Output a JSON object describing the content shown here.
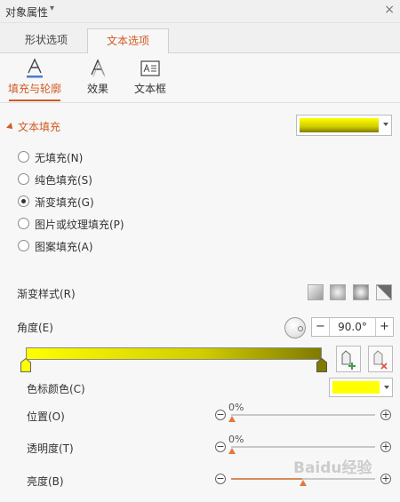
{
  "titlebar": {
    "title": "对象属性",
    "caret": "▾",
    "close": "×"
  },
  "tabs": [
    {
      "label": "形状选项",
      "active": false
    },
    {
      "label": "文本选项",
      "active": true
    }
  ],
  "subtabs": [
    {
      "label": "填充与轮廓",
      "icon": "text-fill-outline-icon",
      "active": true
    },
    {
      "label": "效果",
      "icon": "text-effect-icon",
      "active": false
    },
    {
      "label": "文本框",
      "icon": "textbox-icon",
      "active": false
    }
  ],
  "fill": {
    "section_title": "文本填充",
    "options": [
      {
        "label": "无填充(N)",
        "checked": false
      },
      {
        "label": "纯色填充(S)",
        "checked": false
      },
      {
        "label": "渐变填充(G)",
        "checked": true
      },
      {
        "label": "图片或纹理填充(P)",
        "checked": false
      },
      {
        "label": "图案填充(A)",
        "checked": false
      }
    ],
    "gradient_style_label": "渐变样式(R)",
    "angle_label": "角度(E)",
    "angle_value": "90.0°",
    "stop_color_label": "色标颜色(C)",
    "position_label": "位置(O)",
    "position_value": "0%",
    "transparency_label": "透明度(T)",
    "transparency_value": "0%",
    "brightness_label": "亮度(B)",
    "spin_minus": "−",
    "spin_plus": "+"
  },
  "colors": {
    "accent": "#d25a23",
    "yellow": "#ffff00",
    "olive": "#807a00"
  },
  "watermark": "Baidu经验"
}
